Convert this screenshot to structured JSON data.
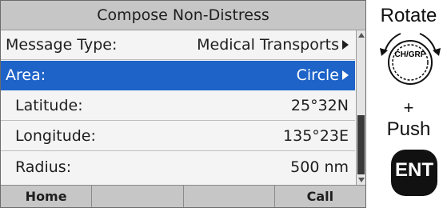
{
  "screen": {
    "title": "Compose Non-Distress",
    "rows": [
      {
        "label": "Message Type:",
        "value": "Medical Transports"
      },
      {
        "label": "Area:",
        "value": "Circle"
      },
      {
        "label": "Latitude:",
        "value": "25°32N"
      },
      {
        "label": "Longitude:",
        "value": "135°23E"
      },
      {
        "label": "Radius:",
        "value": "500 nm"
      }
    ],
    "selected_row_color": "#1e63c8",
    "softkeys": [
      "Home",
      "",
      "",
      "Call"
    ]
  },
  "controls": {
    "rotate_label": "Rotate",
    "knob_label": "CH/GRP",
    "plus_label": "+",
    "push_label": "Push",
    "ent_label": "ENT"
  }
}
